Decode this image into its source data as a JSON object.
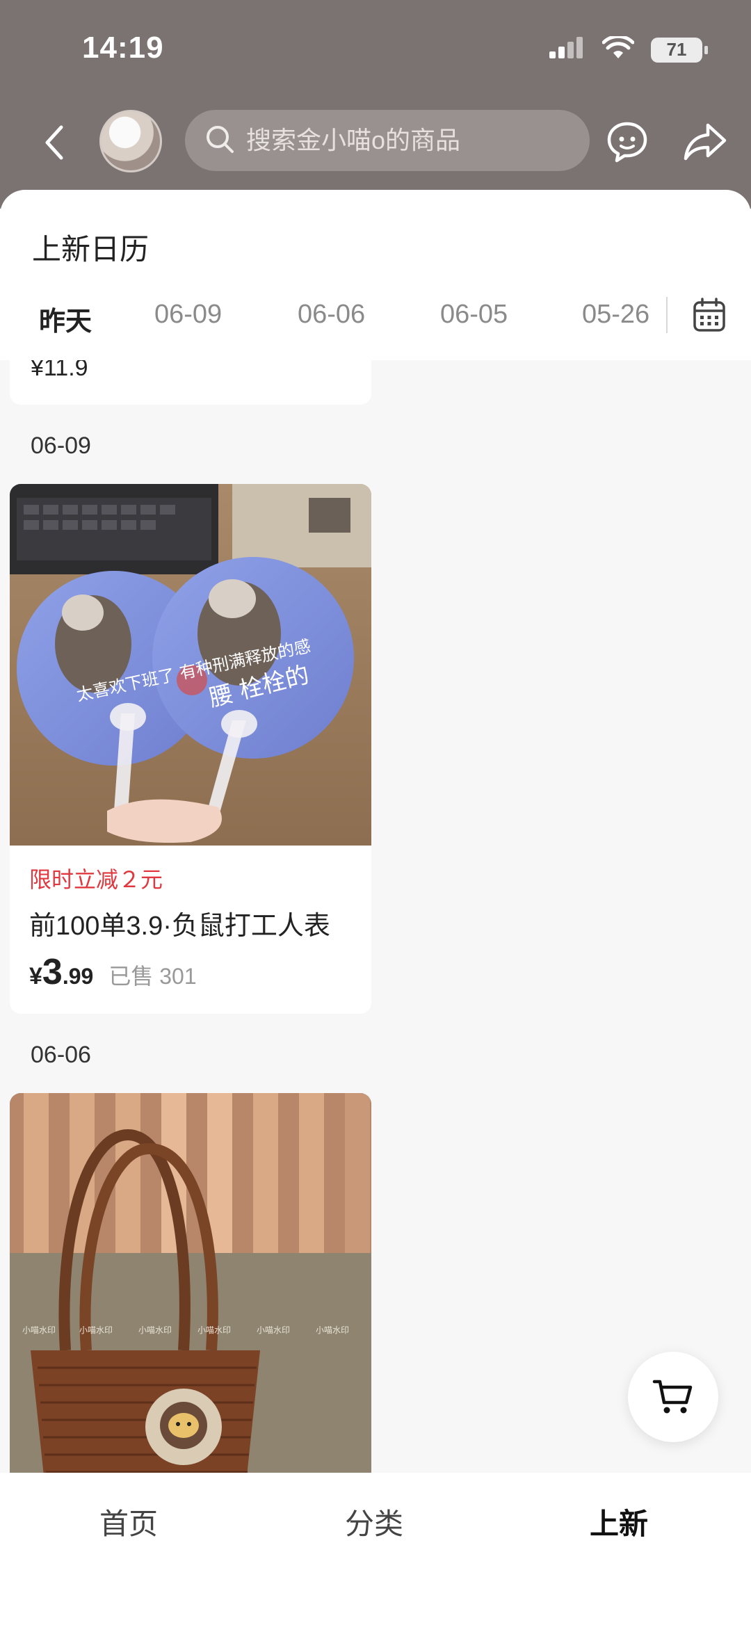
{
  "status": {
    "time": "14:19",
    "battery": "71"
  },
  "header": {
    "search_placeholder": "搜索金小喵ο的商品"
  },
  "sheet": {
    "title": "上新日历",
    "date_tabs": [
      "昨天",
      "06-09",
      "06-06",
      "06-05",
      "05-26"
    ],
    "active_tab_index": 0
  },
  "feed": {
    "partial_card": {
      "price": "¥11.9"
    },
    "sections": [
      {
        "date": "06-09",
        "card": {
          "image_text_left": "太喜欢下班了 有种刑满释放的感",
          "image_text_right": "腰 栓栓的",
          "promo": "限时立减２元",
          "title": "前100单3.9·负鼠打工人表",
          "currency": "¥",
          "price_int": "3",
          "price_dec": ".99",
          "sold": "已售 301"
        }
      },
      {
        "date": "06-06",
        "card": {
          "watermark": "小喵水印"
        }
      }
    ]
  },
  "tabbar": {
    "items": [
      "首页",
      "分类",
      "上新"
    ],
    "active_index": 2
  },
  "colors": {
    "header_bg": "#7b7371",
    "promo_red": "#e0383e"
  }
}
